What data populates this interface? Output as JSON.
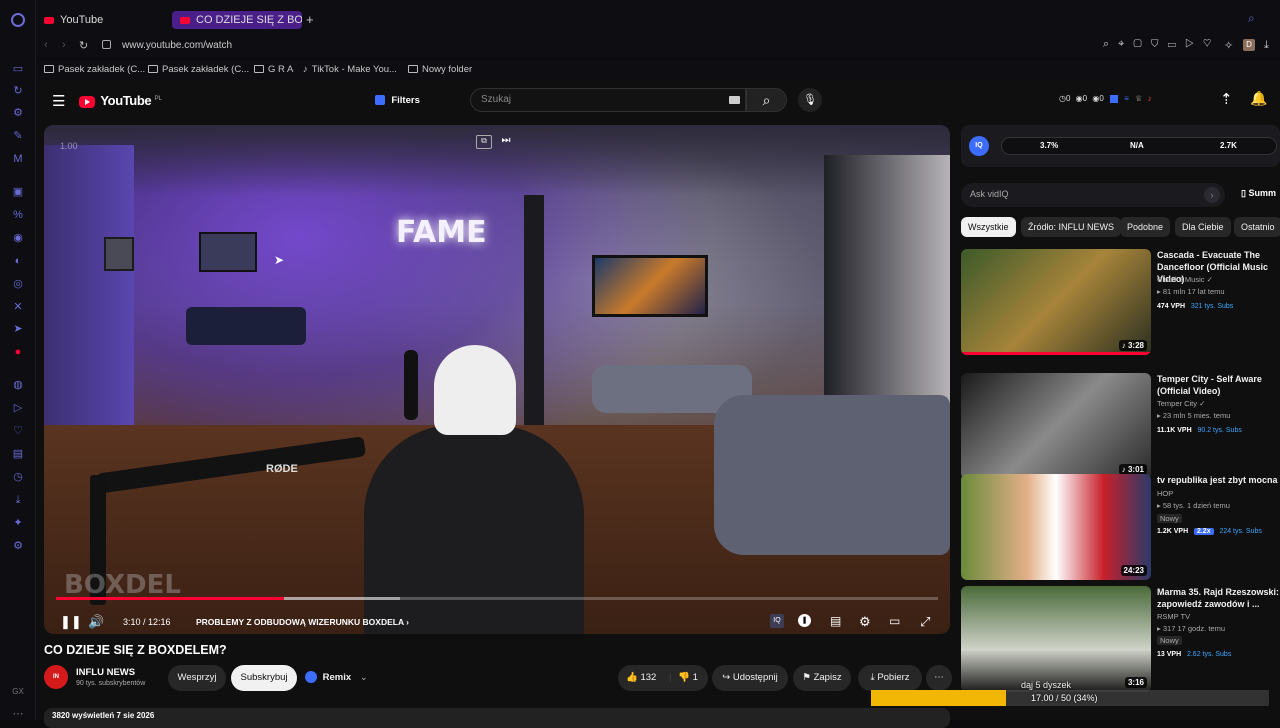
{
  "browser": {
    "tabs": [
      {
        "label": "YouTube"
      },
      {
        "label": "CO DZIEJE SIĘ Z BOXD..."
      }
    ],
    "url": "www.youtube.com/watch",
    "bookmarks": [
      "Pasek zakładek (C...",
      "Pasek zakładek (C...",
      "G R A",
      "TikTok - Make You...",
      "Nowy folder"
    ],
    "sidebar_bottom_text": "GX"
  },
  "header": {
    "logo_text": "YouTube",
    "logo_region": "PL",
    "filters_label": "Filters",
    "search_placeholder": "Szukaj",
    "stats": [
      "0",
      "0",
      "0"
    ]
  },
  "player": {
    "speed_badge": "1.00",
    "time_current": "3:10",
    "time_total": "12:16",
    "time_display": "3:10 / 12:16",
    "chapter": "PROBLEMY Z ODBUDOWĄ WIZERUNKU BOXDELA",
    "progress": 0.258,
    "buffered": 0.39,
    "watermark": "BOXDEL",
    "scene_text_1": "FAME",
    "mic_brand": "RØDE"
  },
  "video": {
    "title": "CO DZIEJE SIĘ Z BOXDELEM?",
    "channel": "INFLU NEWS",
    "subscribers": "90 tys. subskrybentów",
    "support_label": "Wesprzyj",
    "subscribe_label": "Subskrybuj",
    "remix_label": "Remix",
    "likes": "132",
    "dislikes": "1",
    "share_label": "Udostępnij",
    "save_label": "Zapisz",
    "download_label": "Pobierz",
    "views_line": "3820 wyświetleń 7 sie 2026"
  },
  "vidiq": {
    "stats": [
      "3.7%",
      "N/A",
      "2.7K"
    ],
    "ask_placeholder": "Ask vidIQ",
    "summary_label": "Summ"
  },
  "chips": [
    "Wszystkie",
    "Źródło: INFLU NEWS",
    "Podobne",
    "Dla Ciebie",
    "Ostatnio"
  ],
  "recommendations": [
    {
      "title": "Cascada - Evacuate The Dancefloor (Official Music Video)",
      "channel": "Cloud 9 Music",
      "meta": "81 mln  17 lat temu",
      "vph": "474 VPH",
      "subs": "321 tys. Subs",
      "duration": "3:28",
      "badge": "",
      "ratio": ""
    },
    {
      "title": "Temper City - Self Aware (Official Video)",
      "channel": "Temper City",
      "meta": "23 mln  5 mies. temu",
      "vph": "11.1K VPH",
      "subs": "90.2 tys. Subs",
      "duration": "3:01",
      "badge": "",
      "ratio": ""
    },
    {
      "title": "tv republika jest zbyt mocna",
      "channel": "HOP",
      "meta": "58 tys.  1 dzień temu",
      "vph": "1.2K VPH",
      "subs": "224 tys. Subs",
      "duration": "24:23",
      "badge": "Nowy",
      "ratio": "2.2x"
    },
    {
      "title": "Marma 35. Rajd Rzeszowski: zapowiedź zawodów i ...",
      "channel": "RSMP TV",
      "meta": "317  17 godz. temu",
      "vph": "13 VPH",
      "subs": "2.62 tys. Subs",
      "duration": "3:16",
      "badge": "Nowy",
      "ratio": ""
    }
  ],
  "overlay": {
    "line1": "dąj 5 dyszek",
    "line2": "17.00 / 50 (34%)",
    "progress": 0.34
  },
  "colors": {
    "accent": "#ff0033",
    "vidiq": "#3d6dff",
    "link": "#3ea6ff",
    "overlay": "#f2b705"
  }
}
